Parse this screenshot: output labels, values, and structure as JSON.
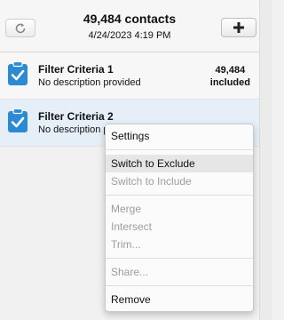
{
  "header": {
    "title": "49,484 contacts",
    "subtitle": "4/24/2023 4:19 PM",
    "refresh_icon": "refresh-icon",
    "add_icon": "plus-icon"
  },
  "filters": [
    {
      "name": "Filter Criteria 1",
      "description": "No description provided",
      "count": "49,484",
      "count_label": "included",
      "icon": "clipboard-check-icon"
    },
    {
      "name": "Filter Criteria 2",
      "description": "No description provided",
      "icon": "clipboard-check-icon"
    }
  ],
  "menu": {
    "settings": "Settings",
    "switch_exclude": "Switch to Exclude",
    "switch_include": "Switch to Include",
    "merge": "Merge",
    "intersect": "Intersect",
    "trim": "Trim...",
    "share": "Share...",
    "remove": "Remove"
  },
  "colors": {
    "accent": "#2a8ad4",
    "selected_row": "#e6eef8"
  }
}
